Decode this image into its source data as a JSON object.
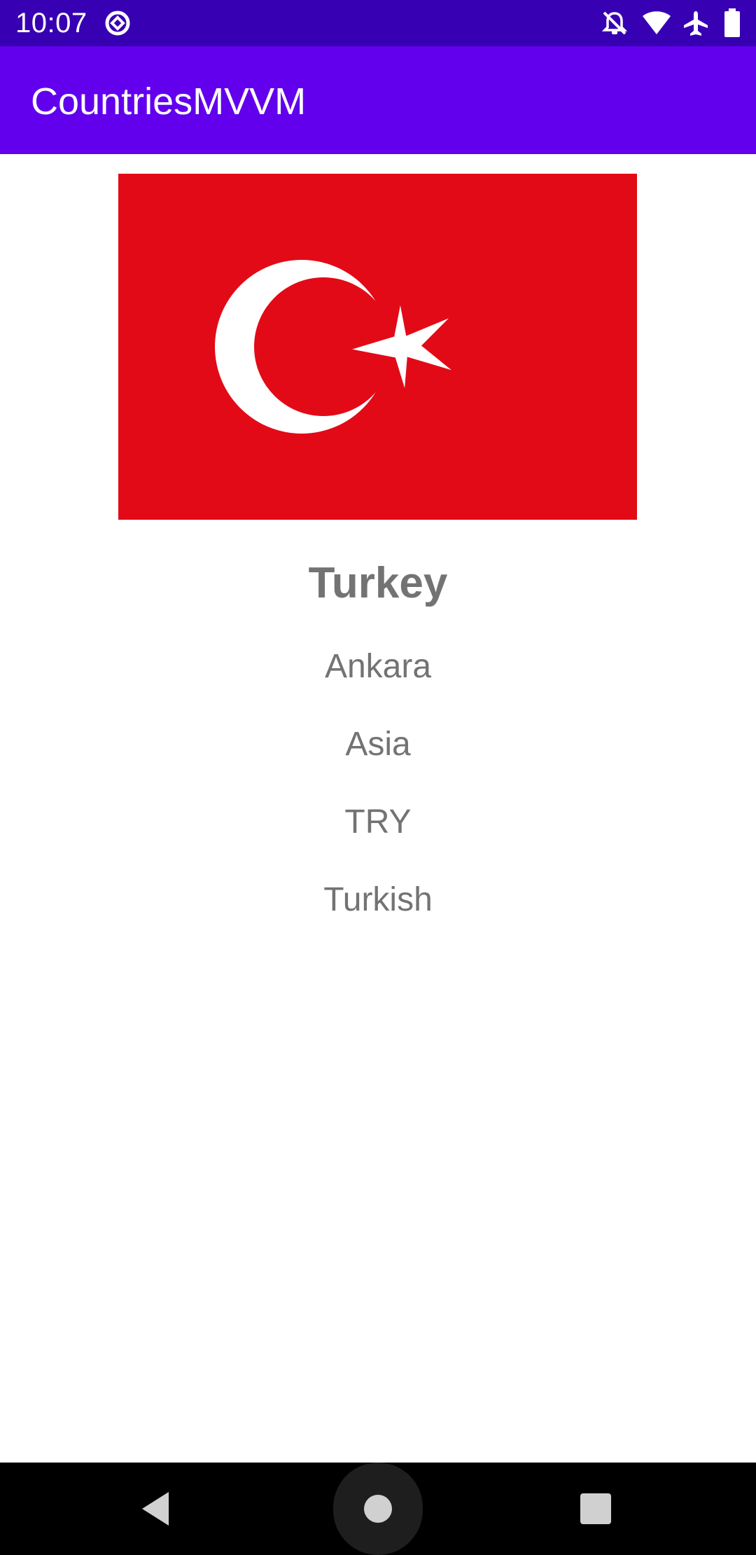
{
  "status_bar": {
    "time": "10:07",
    "icons": [
      "sync-circle-icon",
      "notifications-off-icon",
      "wifi-icon",
      "airplane-icon",
      "battery-icon"
    ]
  },
  "app_bar": {
    "title": "CountriesMVVM"
  },
  "country": {
    "flag_icon": "turkey-flag",
    "name": "Turkey",
    "capital": "Ankara",
    "region": "Asia",
    "currency": "TRY",
    "language": "Turkish"
  },
  "colors": {
    "status_bar": "#3700b3",
    "app_bar": "#6200ee",
    "text_secondary": "#737373",
    "flag_red": "#e30a17",
    "flag_white": "#ffffff"
  },
  "navigation_bar": {
    "buttons": [
      "back-icon",
      "home-icon",
      "recents-icon"
    ]
  }
}
